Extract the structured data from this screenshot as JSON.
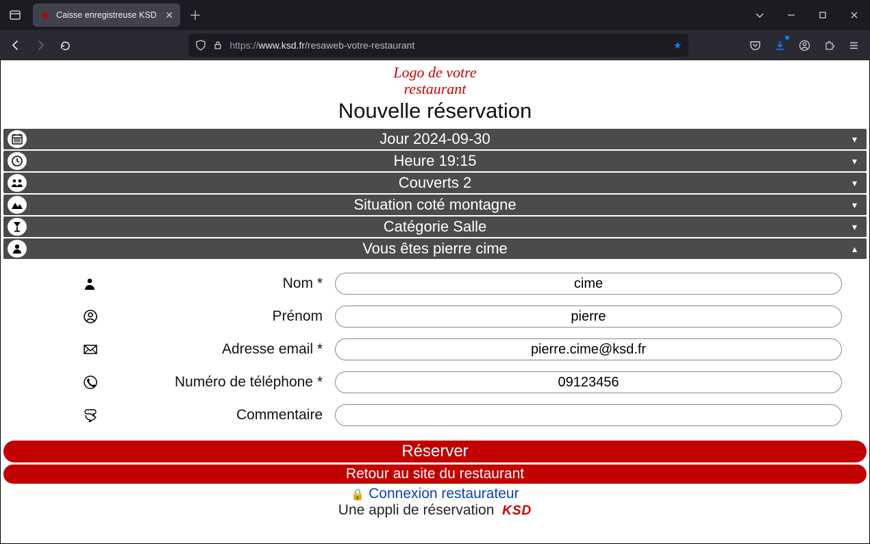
{
  "browser": {
    "tab_title": "Caisse enregistreuse KSD - Notr",
    "url_prefix": "https://",
    "url_host": "www.ksd.fr",
    "url_path": "/resaweb-votre-restaurant"
  },
  "page": {
    "logo_line1": "Logo de votre",
    "logo_line2": "restaurant",
    "heading": "Nouvelle réservation"
  },
  "accordion": {
    "day": "Jour 2024-09-30",
    "time": "Heure 19:15",
    "covers": "Couverts 2",
    "situation": "Situation coté montagne",
    "category": "Catégorie Salle",
    "identity": "Vous êtes pierre  cime"
  },
  "form": {
    "nom_label": "Nom *",
    "nom_value": "cime",
    "prenom_label": "Prénom",
    "prenom_value": "pierre",
    "email_label": "Adresse email *",
    "email_value": "pierre.cime@ksd.fr",
    "tel_label": "Numéro de téléphone *",
    "tel_value": "09123456",
    "comment_label": "Commentaire",
    "comment_value": ""
  },
  "buttons": {
    "reserve": "Réserver",
    "back": "Retour au site du restaurant"
  },
  "footer": {
    "login_link": "Connexion restaurateur",
    "tagline": "Une appli de réservation",
    "brand": "KSD"
  }
}
